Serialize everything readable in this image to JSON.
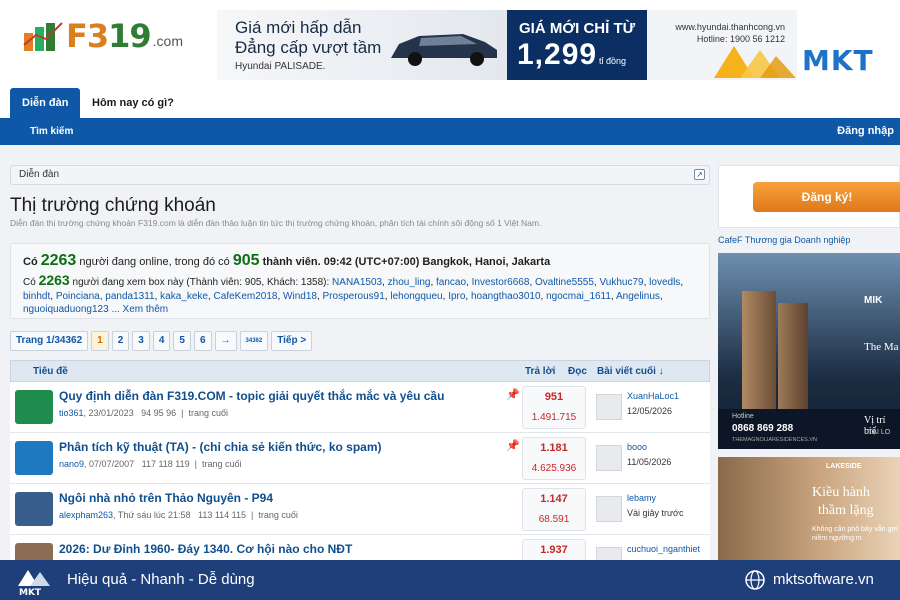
{
  "header": {
    "logo": {
      "text1": "F3",
      "text2": "19",
      "suffix": ".com"
    },
    "banner": {
      "line1": "Giá mới hấp dẫn",
      "line2": "Đẳng cấp vượt tầm",
      "model": "Hyundai PALISADE.",
      "mid_title": "GIÁ MỚI CHỈ TỪ",
      "price": "1,299",
      "unit": "tỉ đồng",
      "url": "www.hyundai.thanhcong.vn",
      "hotline": "Hotline: 1900 56 1212"
    },
    "watermark": "MKT"
  },
  "nav": {
    "tabs": [
      "Diễn đàn",
      "Hôm nay có gì?"
    ],
    "search": "Tìm kiếm",
    "login": "Đăng nhập"
  },
  "breadcrumb": "Diễn đàn",
  "forum": {
    "title": "Thị trường chứng khoán",
    "description": "Diễn đàn thị trường chứng khoán F319.com là diễn đàn thảo luận tin tức thị trường chứng khoán, phân tích tài chính sôi động số 1 Việt Nam."
  },
  "online": {
    "prefix": "Có",
    "count": "2263",
    "mid": "người đang online, trong đó có",
    "members": "905",
    "suffix": "thành viên. 09:42 (UTC+07:00) Bangkok, Hanoi, Jakarta",
    "chat_prefix": "Có",
    "chat_count": "2263",
    "chat_mid": "người đang xem box này (Thành viên: 905, Khách: 1358):",
    "member_list": [
      "NANA1503",
      "zhou_ling",
      "fancao",
      "Investor6668",
      "Ovaltine5555",
      "Vukhuc79",
      "lovedls",
      "binhdt",
      "Poinciana",
      "panda1311",
      "kaka_keke",
      "CafeKem2018",
      "Wind18",
      "Prosperous91",
      "lehongqueu",
      "Ipro",
      "hoangthao3010",
      "ngocmai_1611",
      "Angelinus",
      "nguoiquaduong123"
    ],
    "more": "... Xem thêm"
  },
  "pager": {
    "label": "Trang 1/34362",
    "pages": [
      "1",
      "2",
      "3",
      "4",
      "5",
      "6"
    ],
    "arrow": "→",
    "last": "34362",
    "next": "Tiếp >"
  },
  "table": {
    "headers": {
      "title": "Tiêu đề",
      "replies": "Trả lời",
      "views": "Đọc",
      "last": "Bài viết cuối ↓"
    },
    "rows": [
      {
        "title": "Quy định diễn đàn F319.COM - topic giải quyết thắc mắc và yêu cầu",
        "author": "tio361",
        "date": "23/01/2023",
        "pages": "94  95  96",
        "last_page": "trang cuối",
        "replies": "951",
        "views": "1.491.715",
        "last_user": "XuanHaLoc1",
        "last_date": "12/05/2026",
        "pinned": true,
        "icon_color": "#1f8b4c"
      },
      {
        "title": "Phân tích kỹ thuật (TA) - (chỉ chia sẻ kiến thức, ko spam)",
        "author": "nano9",
        "date": "07/07/2007",
        "pages": "117  118  119",
        "last_page": "trang cuối",
        "replies": "1.181",
        "views": "4.625.936",
        "last_user": "booo",
        "last_date": "11/05/2026",
        "pinned": true,
        "icon_color": "#1e79c0"
      },
      {
        "title": "Ngôi nhà nhỏ trên Thảo Nguyên - P94",
        "author": "alexpham263",
        "date": "Thứ sáu lúc 21:58",
        "pages": "113  114  115",
        "last_page": "trang cuối",
        "replies": "1.147",
        "views": "68.591",
        "last_user": "lebamy",
        "last_date": "Vài giây trước",
        "pinned": false,
        "icon_color": "#3a5e8c"
      },
      {
        "title": "2026: Dư Đỉnh 1960- Đáy 1340. Cơ hội nào cho NĐT",
        "author": "",
        "date": "",
        "pages": "",
        "last_page": "",
        "replies": "1.937",
        "views": "",
        "last_user": "cuchuoi_nganthiet",
        "last_date": "",
        "pinned": false,
        "icon_color": "#8a6d52"
      }
    ]
  },
  "sidebar": {
    "register": "Đăng ký!",
    "cafef": "CafeF Thương gia Doanh nghiệp",
    "ad1": {
      "brand": "MIK",
      "brand2": "The Ma",
      "hotline_label": "Hotline",
      "phone": "0868 869 288",
      "web": "THEMAGNOLIARESIDENCES.VN",
      "tag": "Vị trí biể",
      "tag2": "TẠI LO"
    },
    "ad2": {
      "brand": "LAKESIDE",
      "title1": "Kiều hành",
      "title2": "thầm lặng",
      "sub": "Không cần phô bày vẫn gợi niềm ngưỡng m"
    }
  },
  "footer": {
    "slogan": "Hiệu quả - Nhanh - Dễ dùng",
    "site": "mktsoftware.vn"
  }
}
